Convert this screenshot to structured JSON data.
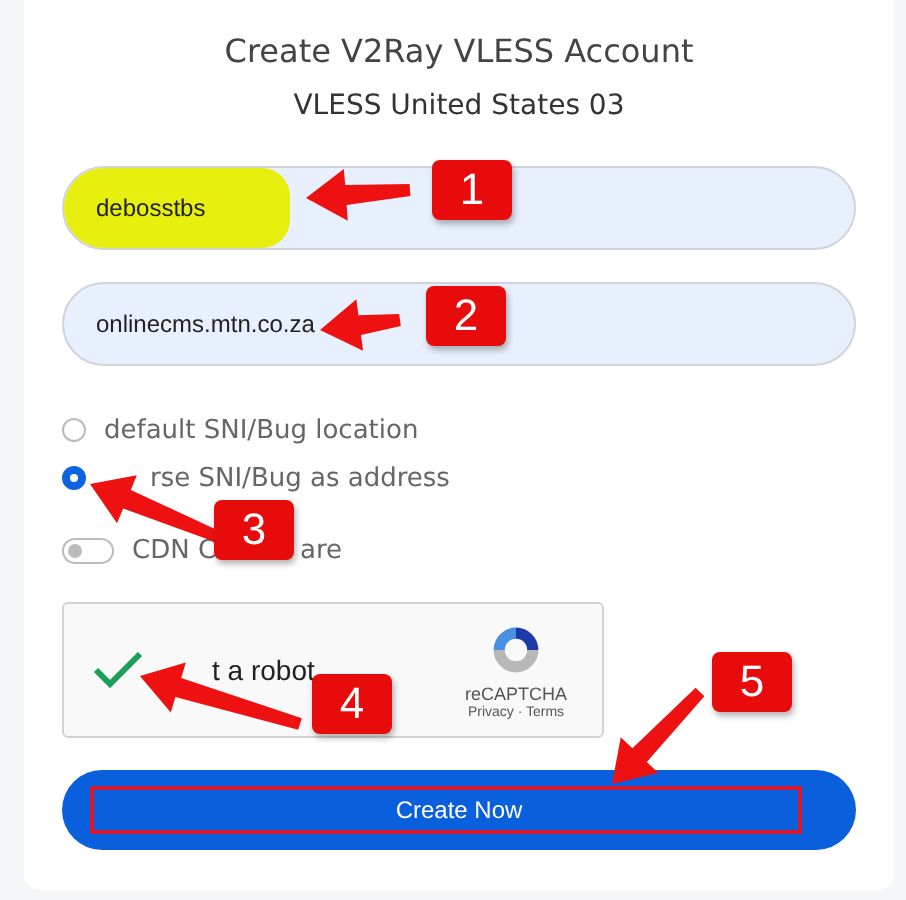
{
  "header": {
    "title": "Create V2Ray VLESS Account",
    "subtitle": "VLESS United States 03"
  },
  "fields": [
    {
      "value": "debosstbs",
      "highlighted": true
    },
    {
      "value": "onlinecms.mtn.co.za",
      "highlighted": false
    }
  ],
  "options": [
    {
      "kind": "radio",
      "label_parts": [
        "default SNI/Bug location"
      ],
      "selected": false
    },
    {
      "kind": "radio",
      "label_parts": [
        "rse SNI/Bug as address"
      ],
      "selected": true,
      "covered_start": true
    },
    {
      "kind": "toggle",
      "label_parts": [
        "CDN C",
        "are"
      ],
      "on": false
    }
  ],
  "captcha": {
    "checked": true,
    "label": "t a robot",
    "brand": "reCAPTCHA",
    "links": "Privacy · Terms"
  },
  "submit": {
    "label": "Create Now"
  },
  "callouts": [
    {
      "number": "1"
    },
    {
      "number": "2"
    },
    {
      "number": "3"
    },
    {
      "number": "4"
    },
    {
      "number": "5"
    }
  ]
}
